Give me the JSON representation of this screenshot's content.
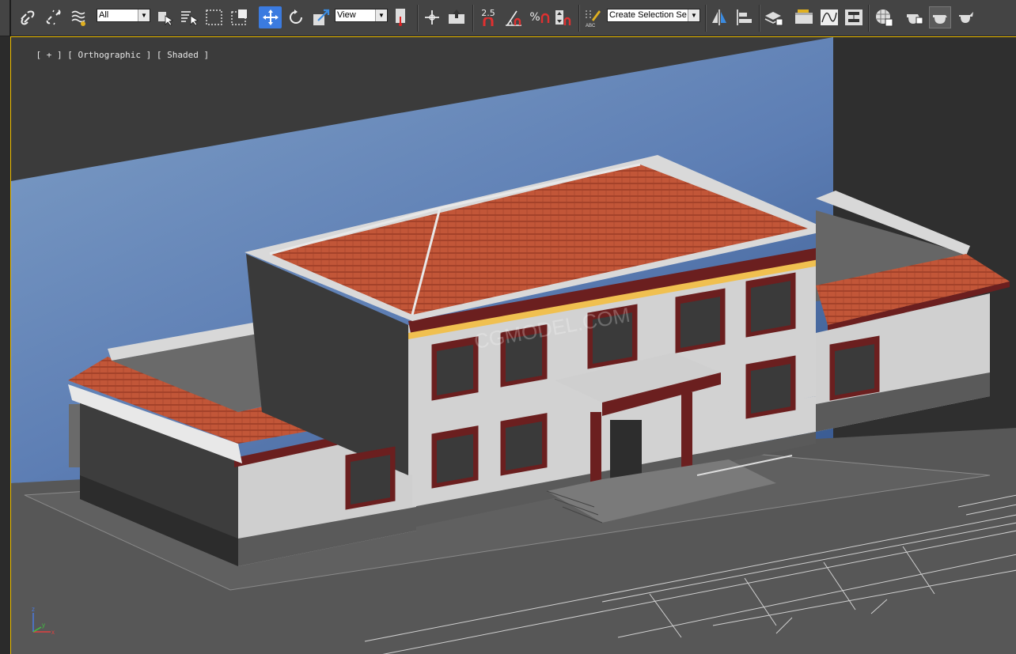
{
  "toolbar": {
    "selection_filter": "All",
    "reference_coord": "View",
    "snap_angle": "2.5",
    "percent_snap": "%",
    "named_selection": "Create Selection Se",
    "icons": [
      "link-icon",
      "unlink-icon",
      "bind-space-warp-icon",
      "select-object-icon",
      "select-by-name-icon",
      "rect-selection-region-icon",
      "window-crossing-icon",
      "select-move-icon",
      "select-rotate-icon",
      "select-scale-icon",
      "use-pivot-center-icon",
      "select-manipulate-icon",
      "keyboard-shortcut-override-icon",
      "snaps-toggle-icon",
      "angle-snap-icon",
      "percent-snap-icon",
      "spinner-snap-icon",
      "edit-named-selection-icon",
      "mirror-icon",
      "align-icon",
      "layer-manager-icon",
      "scene-explorer-icon",
      "curve-editor-icon",
      "schematic-view-icon",
      "material-editor-icon",
      "render-setup-icon",
      "rendered-frame-icon",
      "render-production-icon"
    ]
  },
  "viewport": {
    "label": "[ + ] Orthographic ] Shaded ]",
    "label_parts": [
      "[ + ]",
      "Orthographic",
      "]",
      "Shaded",
      "]"
    ],
    "axis_x": "x",
    "axis_y": "y",
    "axis_z": "z",
    "colors": {
      "active_border": "#f0c000",
      "sky_top": "#6a8fc0",
      "roof_tile": "#c4573a",
      "wall": "#cfcfcf",
      "trim": "#6b1f1f"
    }
  }
}
